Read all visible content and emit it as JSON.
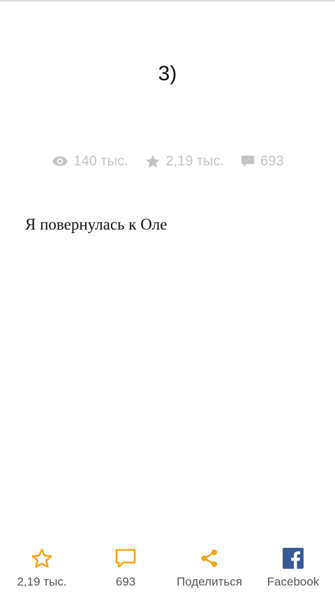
{
  "chapter": {
    "title": "3)"
  },
  "stats": {
    "views": "140 тыс.",
    "votes": "2,19 тыс.",
    "comments": "693"
  },
  "story": {
    "text": "Я повернулась к Оле"
  },
  "bottom_bar": {
    "vote_label": "2,19 тыс.",
    "comments_label": "693",
    "share_label": "Поделиться",
    "facebook_label": "Facebook"
  },
  "colors": {
    "accent": "#f5a31a",
    "stat_gray": "#c4c4c4",
    "facebook_blue": "#3b5998"
  },
  "icons": {
    "views": "eye-icon",
    "votes": "star-icon",
    "comments": "comment-icon",
    "share": "share-icon",
    "facebook": "facebook-icon"
  }
}
